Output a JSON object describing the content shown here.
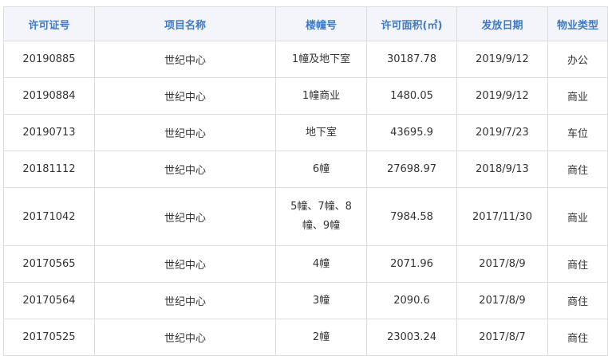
{
  "table": {
    "headers": [
      "许可证号",
      "项目名称",
      "楼幢号",
      "许可面积(㎡)",
      "发放日期",
      "物业类型"
    ],
    "rows": [
      {
        "permit_no": "20190885",
        "project": "世纪中心",
        "building": "1幢及地下室",
        "area": "30187.78",
        "date": "2019/9/12",
        "type": "办公"
      },
      {
        "permit_no": "20190884",
        "project": "世纪中心",
        "building": "1幢商业",
        "area": "1480.05",
        "date": "2019/9/12",
        "type": "商业"
      },
      {
        "permit_no": "20190713",
        "project": "世纪中心",
        "building": "地下室",
        "area": "43695.9",
        "date": "2019/7/23",
        "type": "车位"
      },
      {
        "permit_no": "20181112",
        "project": "世纪中心",
        "building": "6幢",
        "area": "27698.97",
        "date": "2018/9/13",
        "type": "商住"
      },
      {
        "permit_no": "20171042",
        "project": "世纪中心",
        "building": "5幢、7幢、8幢、9幢",
        "area": "7984.58",
        "date": "2017/11/30",
        "type": "商业"
      },
      {
        "permit_no": "20170565",
        "project": "世纪中心",
        "building": "4幢",
        "area": "2071.96",
        "date": "2017/8/9",
        "type": "商住"
      },
      {
        "permit_no": "20170564",
        "project": "世纪中心",
        "building": "3幢",
        "area": "2090.6",
        "date": "2017/8/9",
        "type": "商住"
      },
      {
        "permit_no": "20170525",
        "project": "世纪中心",
        "building": "2幢",
        "area": "23003.24",
        "date": "2017/8/7",
        "type": "商住"
      }
    ]
  }
}
